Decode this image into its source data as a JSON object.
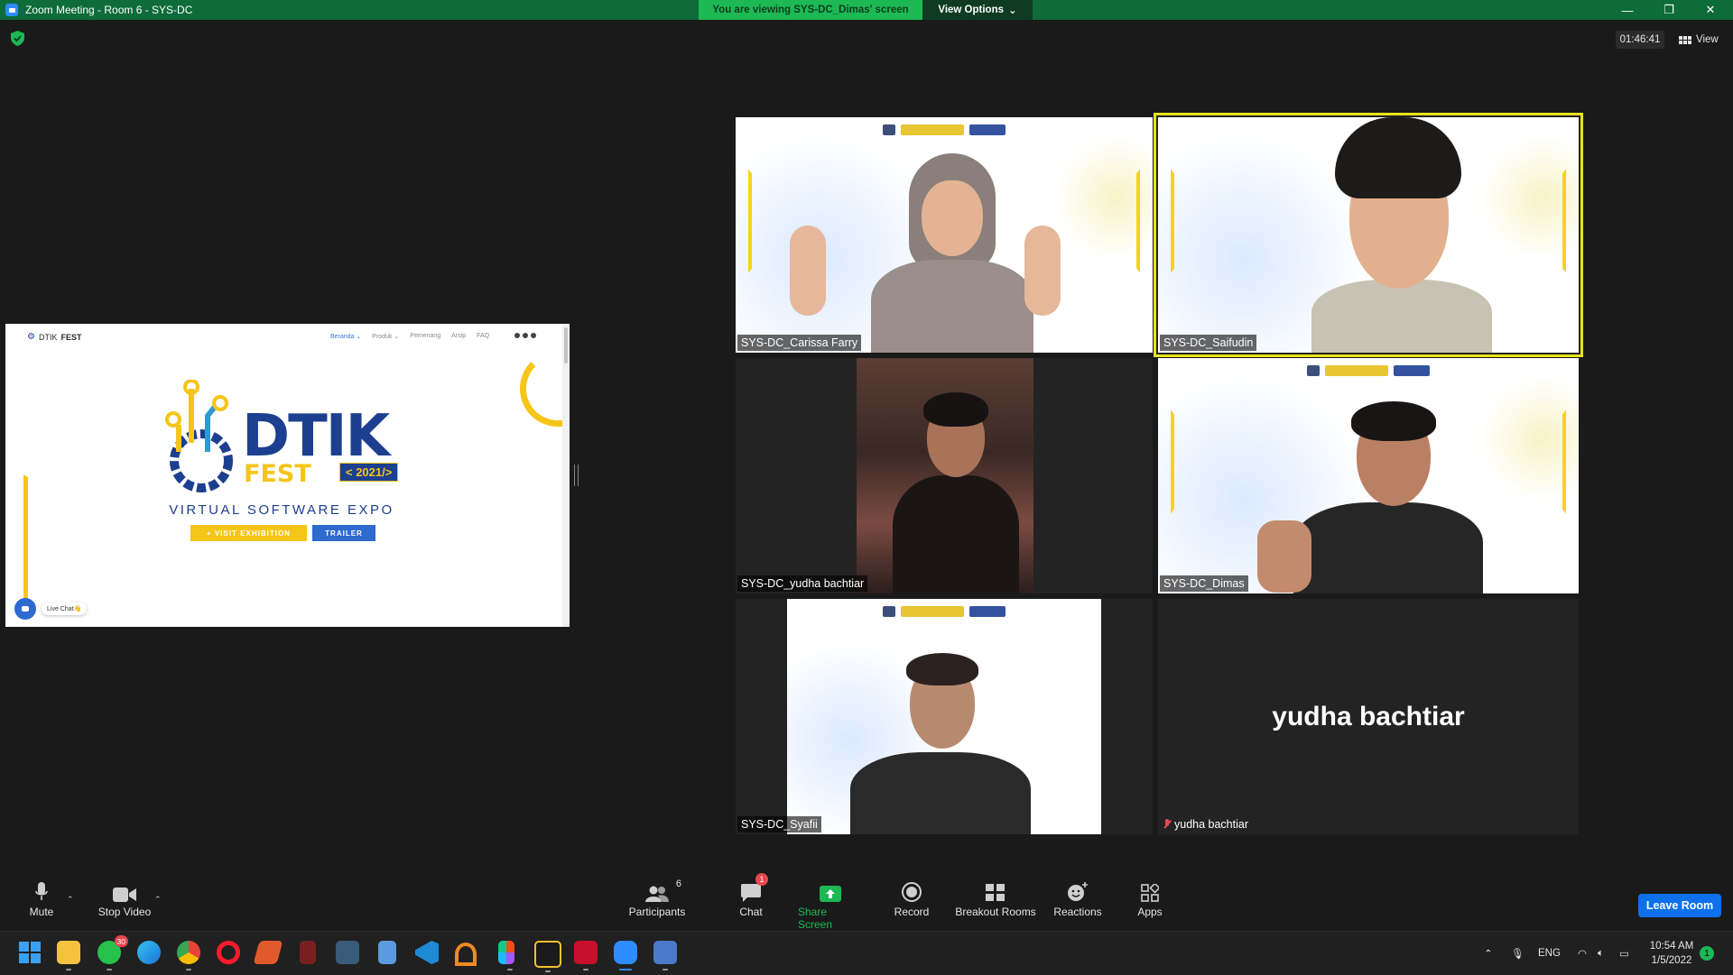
{
  "window": {
    "title": "Zoom Meeting - Room 6 - SYS-DC",
    "viewing_banner": "You are viewing SYS-DC_Dimas' screen",
    "view_options": "View Options",
    "minimize": "—",
    "restore": "❐",
    "close": "✕"
  },
  "overlay": {
    "timer": "01:46:41",
    "view_label": "View"
  },
  "shared_screen": {
    "nav_brand_1": "DTIK",
    "nav_brand_2": "FEST",
    "nav_links": [
      "Beranda ⌄",
      "Produk ⌄",
      "Pemenang",
      "Arsip",
      "FAQ"
    ],
    "logo_word": "DTIK",
    "logo_fest": "FEST",
    "logo_year": "< 2021/>",
    "subtitle": "VIRTUAL SOFTWARE EXPO",
    "visit_button": "+ VISIT EXHIBITION",
    "trailer_button": "TRAILER",
    "live_chat": "Live Chat👋"
  },
  "participants": [
    {
      "name": "SYS-DC_Carissa Farry"
    },
    {
      "name": "SYS-DC_Saifudin"
    },
    {
      "name": "SYS-DC_yudha bachtiar"
    },
    {
      "name": "SYS-DC_Dimas"
    },
    {
      "name": "SYS-DC_Syafii"
    },
    {
      "name": "yudha bachtiar",
      "display_name": "yudha bachtiar",
      "muted": true
    }
  ],
  "toolbar": {
    "mute": "Mute",
    "stop_video": "Stop Video",
    "participants": "Participants",
    "participants_count": "6",
    "chat": "Chat",
    "chat_badge": "1",
    "share_screen": "Share Screen",
    "record": "Record",
    "breakout_rooms": "Breakout Rooms",
    "reactions": "Reactions",
    "apps": "Apps",
    "leave_room": "Leave Room"
  },
  "taskbar": {
    "whatsapp_badge": "30",
    "language": "ENG",
    "time": "10:54 AM",
    "date": "1/5/2022",
    "notification_count": "1"
  },
  "colors": {
    "titlebar": "#0e6b3a",
    "banner": "#1db954",
    "active_speaker": "#e8e21c",
    "leave": "#0e71eb",
    "share_green": "#1db954",
    "dtik_blue": "#1d3f8f",
    "dtik_yellow": "#f5c518"
  }
}
